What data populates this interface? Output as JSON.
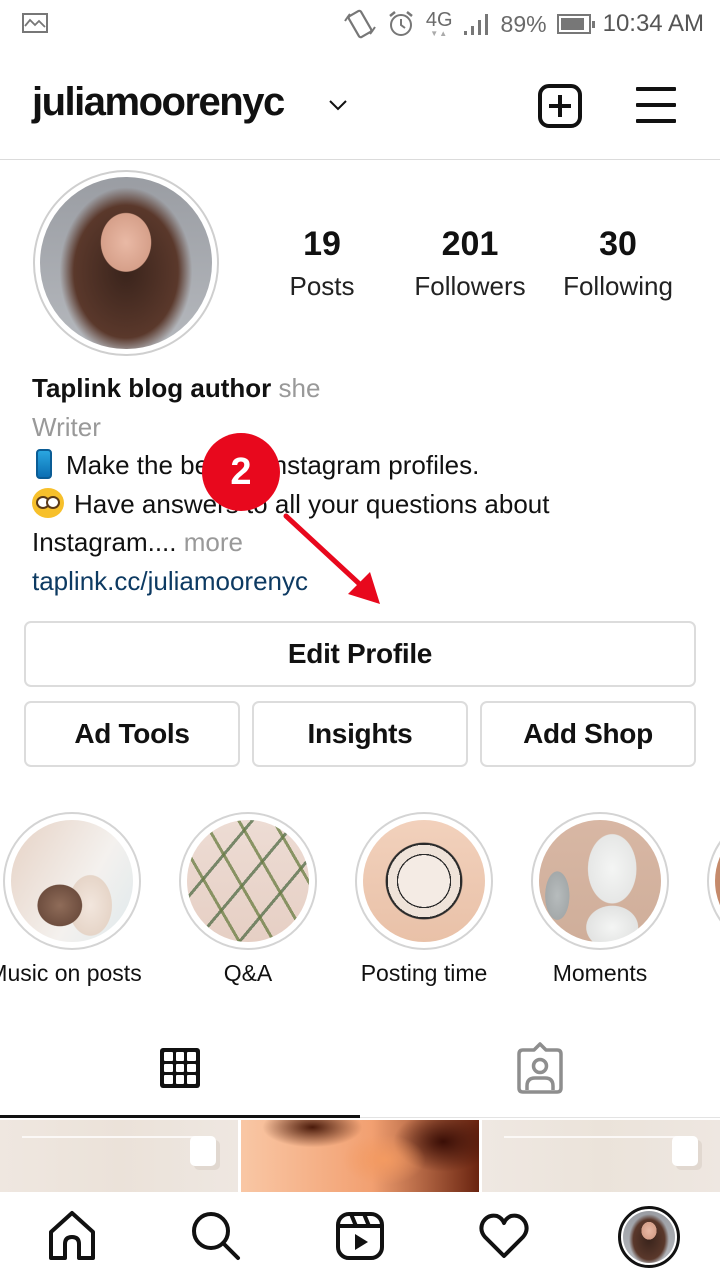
{
  "status_bar": {
    "left_icon": "gallery-notification-icon",
    "icons": [
      "vibrate-icon",
      "alarm-icon",
      "network-4g-icon",
      "signal-icon",
      "battery-icon"
    ],
    "network": "4G",
    "battery_percent": "89%",
    "battery_level": 0.89,
    "time": "10:34 AM"
  },
  "header": {
    "username": "juliamoorenyc",
    "account_switch_icon": "chevron-down-icon",
    "new_post_icon": "plus-square-icon",
    "menu_icon": "hamburger-menu-icon"
  },
  "profile": {
    "avatar_alt": "Profile photo of Julia Moore",
    "stats": [
      {
        "value": "19",
        "label": "Posts"
      },
      {
        "value": "201",
        "label": "Followers"
      },
      {
        "value": "30",
        "label": "Following"
      }
    ],
    "bio": {
      "name": "Taplink blog author",
      "pronoun": "she",
      "category": "Writer",
      "line1_emoji": "mobile-phone-emoji",
      "line1_text": "Make the best of Instagram profiles.",
      "line2_emoji": "nerd-face-emoji",
      "line2_text": "Have answers to all your questions about",
      "line3_text": "Instagram....",
      "more_label": "more",
      "link": "taplink.cc/juliamoorenyc"
    }
  },
  "actions": {
    "edit_profile": "Edit Profile",
    "ad_tools": "Ad Tools",
    "insights": "Insights",
    "add_shop": "Add Shop"
  },
  "highlights": [
    {
      "label": "Music on posts"
    },
    {
      "label": "Q&A"
    },
    {
      "label": "Posting time"
    },
    {
      "label": "Moments"
    },
    {
      "label": ""
    }
  ],
  "tabs": [
    {
      "name": "posts-grid",
      "icon": "grid-icon",
      "active": true
    },
    {
      "name": "tagged",
      "icon": "tagged-user-icon",
      "active": false
    }
  ],
  "posts": [
    {
      "type": "carousel"
    },
    {
      "type": "single"
    },
    {
      "type": "carousel"
    }
  ],
  "bottom_nav": [
    {
      "name": "home",
      "icon": "home-icon"
    },
    {
      "name": "search",
      "icon": "search-icon"
    },
    {
      "name": "reels",
      "icon": "reels-icon"
    },
    {
      "name": "activity",
      "icon": "heart-icon"
    },
    {
      "name": "profile",
      "icon": "profile-avatar"
    }
  ],
  "annotation": {
    "step_number": "2",
    "color": "#e8081d",
    "points_to": "Edit Profile"
  }
}
